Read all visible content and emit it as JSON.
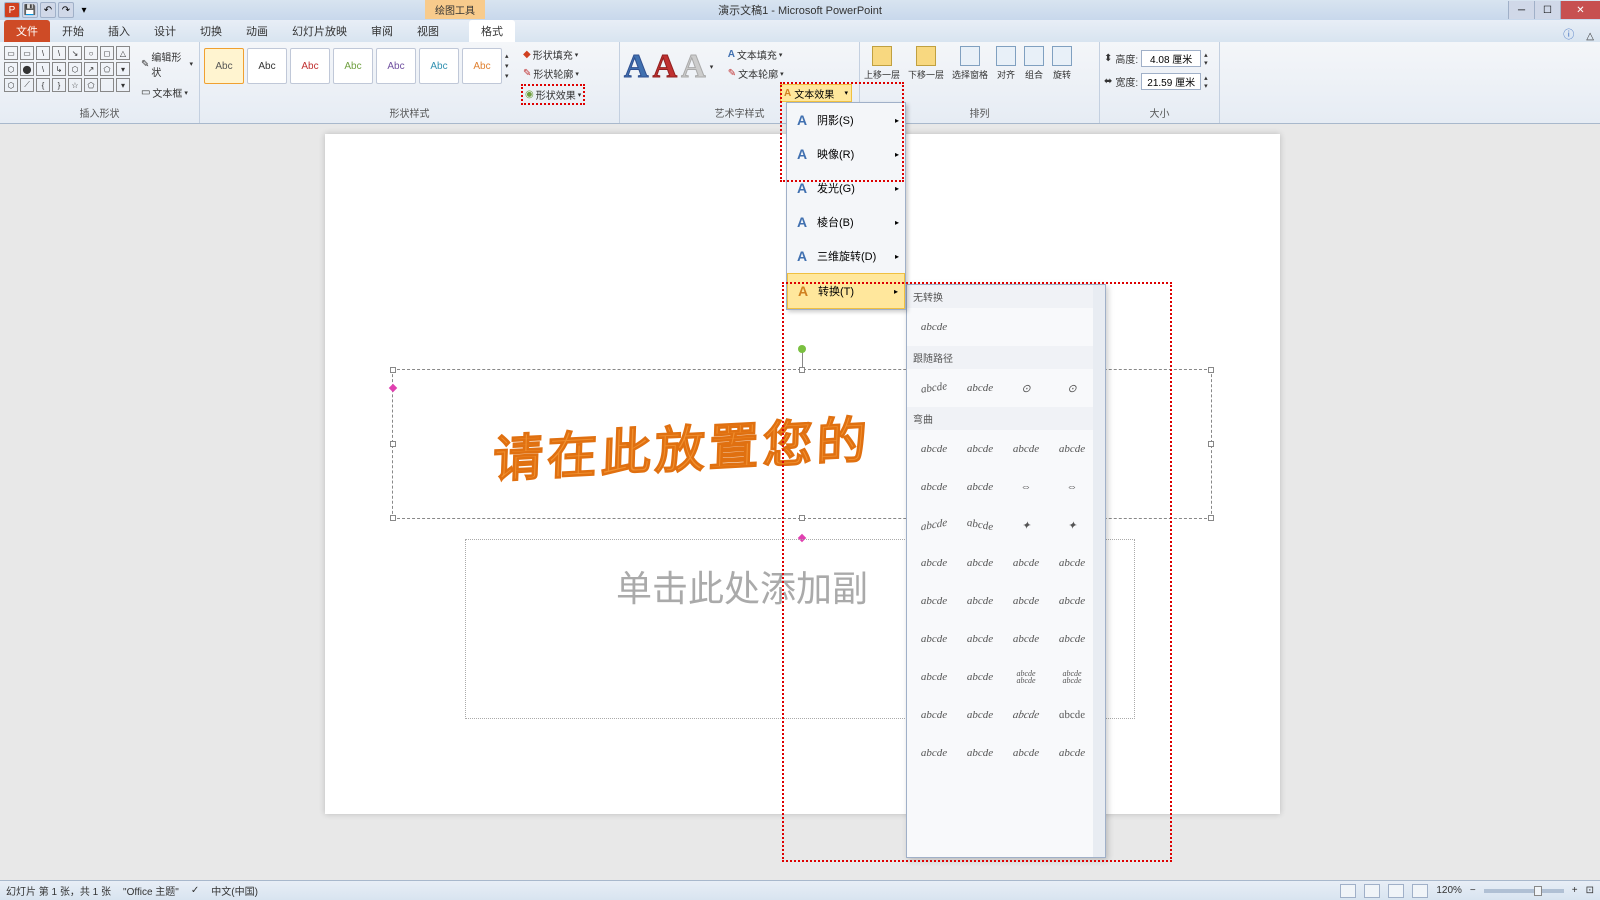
{
  "titlebar": {
    "contextual_tab": "绘图工具",
    "document_title": "演示文稿1 - Microsoft PowerPoint"
  },
  "tabs": {
    "file": "文件",
    "items": [
      "开始",
      "插入",
      "设计",
      "切换",
      "动画",
      "幻灯片放映",
      "审阅",
      "视图"
    ],
    "format": "格式"
  },
  "ribbon": {
    "insert_shapes": {
      "label": "插入形状",
      "edit_shape": "编辑形状",
      "text_box": "文本框"
    },
    "shape_styles": {
      "label": "形状样式",
      "swatch": "Abc",
      "fill": "形状填充",
      "outline": "形状轮廓",
      "effects": "形状效果"
    },
    "wordart_styles": {
      "label": "艺术字样式",
      "text_fill": "文本填充",
      "text_outline": "文本轮廓",
      "text_effects": "文本效果"
    },
    "arrange": {
      "label": "排列",
      "bring_forward": "上移一层",
      "send_backward": "下移一层",
      "selection_pane": "选择窗格",
      "align": "对齐",
      "group": "组合",
      "rotate": "旋转"
    },
    "size": {
      "label": "大小",
      "height_label": "高度:",
      "height_value": "4.08 厘米",
      "width_label": "宽度:",
      "width_value": "21.59 厘米"
    }
  },
  "fx_menu": {
    "shadow": "阴影(S)",
    "reflection": "映像(R)",
    "glow": "发光(G)",
    "bevel": "棱台(B)",
    "rotation_3d": "三维旋转(D)",
    "transform": "转换(T)"
  },
  "transform_gallery": {
    "no_transform": "无转换",
    "sample_text": "abcde",
    "follow_path": "跟随路径",
    "warp": "弯曲"
  },
  "slide": {
    "title_text": "请在此放置您的",
    "subtitle_placeholder": "单击此处添加副"
  },
  "statusbar": {
    "slide_info": "幻灯片 第 1 张，共 1 张",
    "theme": "\"Office 主题\"",
    "language": "中文(中国)",
    "zoom": "120%"
  }
}
